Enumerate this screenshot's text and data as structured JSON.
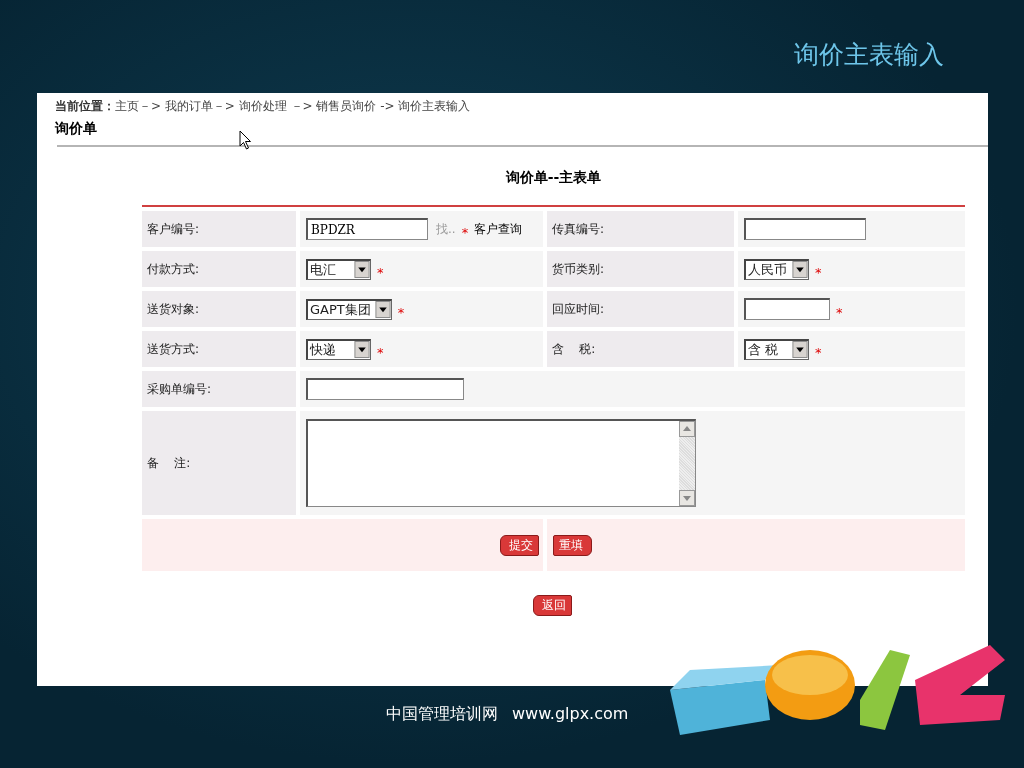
{
  "slide_title": "询价主表输入",
  "breadcrumb": {
    "label": "当前位置：",
    "path": "主页－> 我的订单－> 询价处理 －> 销售员询价 -> 询价主表输入"
  },
  "page_heading": "询价单",
  "form": {
    "title": "询价单--主表单",
    "required_mark": "*",
    "rows": [
      {
        "fields": [
          {
            "label": "客户编号:",
            "kind": "text",
            "value": "BPDZR",
            "required": true,
            "lookup_hint": "找..",
            "lookup_link": "客户查询"
          },
          {
            "label": "传真编号:",
            "kind": "text",
            "required": false
          }
        ]
      },
      {
        "fields": [
          {
            "label": "付款方式:",
            "kind": "select",
            "value": "电汇",
            "required": true
          },
          {
            "label": "货币类别:",
            "kind": "select",
            "value": "人民币",
            "required": true
          }
        ]
      },
      {
        "fields": [
          {
            "label": "送货对象:",
            "kind": "select",
            "value": "GAPT集团",
            "required": true
          },
          {
            "label": "回应时间:",
            "kind": "text",
            "required": true
          }
        ]
      },
      {
        "fields": [
          {
            "label": "送货方式:",
            "kind": "select",
            "value": "快递",
            "required": true
          },
          {
            "label": "含    税:",
            "kind": "select",
            "value": "含 税",
            "required": true
          }
        ]
      },
      {
        "fields": [
          {
            "label": "采购单编号:",
            "kind": "text",
            "required": false
          }
        ]
      },
      {
        "fields": [
          {
            "label": "备    注:",
            "kind": "textarea",
            "required": false
          }
        ]
      }
    ],
    "buttons": [
      "提交",
      "重填"
    ]
  },
  "back_button": "返回",
  "footer": {
    "site": "中国管理培训网",
    "url": "www.glpx.com"
  }
}
